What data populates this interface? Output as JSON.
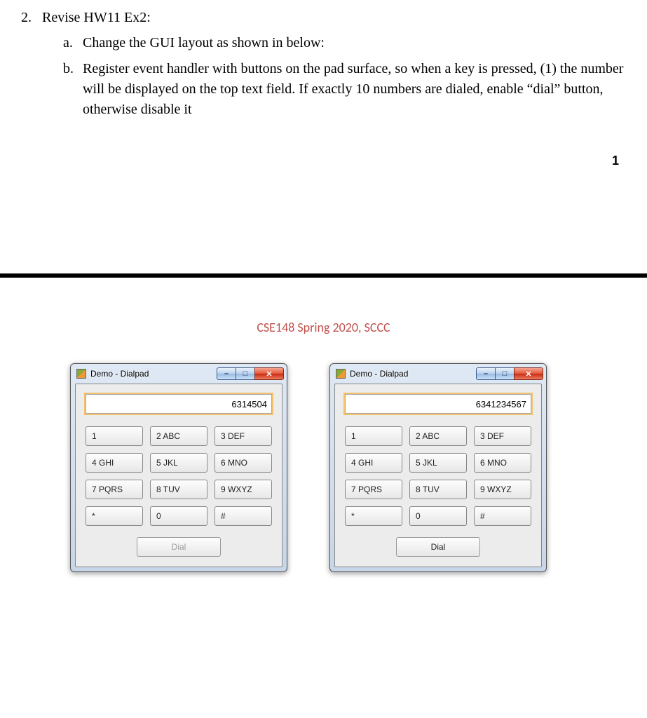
{
  "problem": {
    "number": "2.",
    "title": "Revise HW11 Ex2:",
    "items": {
      "a": {
        "letter": "a.",
        "text": "Change the GUI layout as shown in below:"
      },
      "b": {
        "letter": "b.",
        "text": "Register event handler with buttons on the pad surface, so when a key is pressed, (1) the number will be displayed on the top text field. If exactly 10 numbers are dialed, enable “dial” button, otherwise disable it"
      }
    }
  },
  "page_number": "1",
  "course_heading": "CSE148 Spring 2020, SCCC",
  "window_title": "Demo - Dialpad",
  "winbtn_min": "–",
  "winbtn_max": "□",
  "winbtn_close": "✕",
  "keypad": {
    "k1": "1",
    "k2": "2 ABC",
    "k3": "3 DEF",
    "k4": "4 GHI",
    "k5": "5 JKL",
    "k6": "6 MNO",
    "k7": "7 PQRS",
    "k8": "8 TUV",
    "k9": "9 WXYZ",
    "kstar": "*",
    "k0": "0",
    "khash": "#"
  },
  "dial_label": "Dial",
  "windows": {
    "left": {
      "display_value": "6314504"
    },
    "right": {
      "display_value": "6341234567"
    }
  }
}
